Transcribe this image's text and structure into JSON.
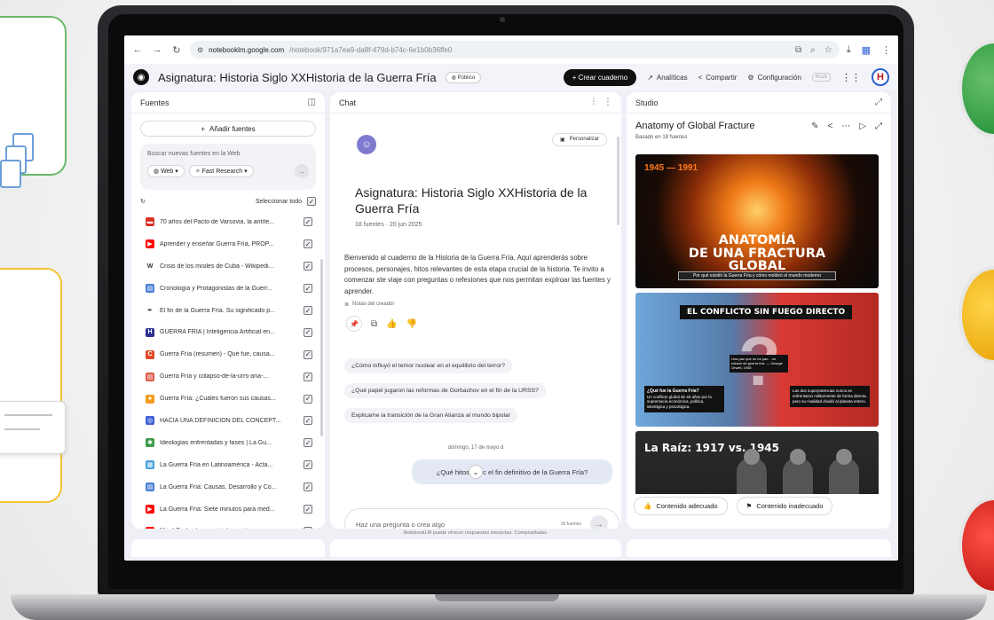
{
  "browser": {
    "url_host": "notebooklm.google.com",
    "url_path": "/notebook/971a7ea9-da8f-479d-b74c-6e1b0b36ffe0"
  },
  "header": {
    "notebook_title": "Asignatura: Historia Siglo XXHistoria de la Guerra Fría",
    "visibility": "Público",
    "create_label": "Crear cuaderno",
    "analytics_label": "Analíticas",
    "share_label": "Compartir",
    "settings_label": "Configuración",
    "plus_badge": "PLUS",
    "avatar_letter": "H"
  },
  "sources": {
    "panel_title": "Fuentes",
    "add_label": "Añadir fuentes",
    "search_placeholder": "Buscar nuevas fuentes en la Web",
    "web_chip": "Web",
    "research_chip": "Fast Research",
    "select_all": "Seleccionar todo",
    "items": [
      {
        "label": "70 años del Pacto de Varsovia, la antíte...",
        "icon": "doc-red-icon",
        "color": "#d93025",
        "glyph": "▬"
      },
      {
        "label": "Aprender y enseñar Guerra Fría, PROP...",
        "icon": "youtube-icon",
        "color": "#ff0000",
        "glyph": "▶"
      },
      {
        "label": "Crisis de los misiles de Cuba - Wikipedi...",
        "icon": "wikipedia-icon",
        "color": "#ffffff",
        "glyph": "W"
      },
      {
        "label": "Cronología y Protagonistas de la Guerr...",
        "icon": "pdf-icon",
        "color": "#4a7fd6",
        "glyph": "▤"
      },
      {
        "label": "El fin de la Guerra Fría. Su significado p...",
        "icon": "quill-icon",
        "color": "#ffffff",
        "glyph": "✒"
      },
      {
        "label": "GUERRA FRÍA | Inteligencia Artificial en...",
        "icon": "h-logo-icon",
        "color": "#2b2f8f",
        "glyph": "H"
      },
      {
        "label": "Guerra Fría (resumen) - Qué fue, causa...",
        "icon": "c-logo-icon",
        "color": "#e24a28",
        "glyph": "C"
      },
      {
        "label": "Guerra Fría y colapso-de-la-urrs-ana-...",
        "icon": "pdf-red-icon",
        "color": "#e05a4b",
        "glyph": "▤"
      },
      {
        "label": "Guerra Fría: ¿Cuáles fueron sus causas...",
        "icon": "flame-icon",
        "color": "#f29b1d",
        "glyph": "●"
      },
      {
        "label": "HACIA UNA DEFINICIÓN DEL CONCEPT...",
        "icon": "globe-blue-icon",
        "color": "#3f5fd8",
        "glyph": "◎"
      },
      {
        "label": "Ideologías enfrentadas y fases | La Gu...",
        "icon": "puzzle-icon",
        "color": "#3b9c4a",
        "glyph": "✱"
      },
      {
        "label": "La Guerra Fría en Latinoamérica - Acta...",
        "icon": "image-icon",
        "color": "#4aa3df",
        "glyph": "▦"
      },
      {
        "label": "La Guerra Fría: Causas, Desarrollo y Co...",
        "icon": "pdf-icon",
        "color": "#4a7fd6",
        "glyph": "▤"
      },
      {
        "label": "La Guerra Fría: Siete minutos para med...",
        "icon": "youtube-icon",
        "color": "#ff0000",
        "glyph": "▶"
      },
      {
        "label": "Mijail Gorbachov: quién fue y cómo ma...",
        "icon": "youtube-icon",
        "color": "#ff0000",
        "glyph": "▶"
      }
    ]
  },
  "chat": {
    "panel_title": "Chat",
    "personalize": "Personalizar",
    "title": "Asignatura: Historia Siglo XXHistoria de la Guerra Fría",
    "meta": "18 fuentes · 20 jun 2025",
    "description": "Bienvenido al cuaderno de la Historia de la Guerra Fría. Aquí aprenderás sobre procesos, personajes, hitos relevantes de esta etapa crucial de la historia. Te invito a comenzar ste viaje con preguntas o refexiones que nos permitan explroar las fuentes y aprender.",
    "creator_notes": "Notas del creador",
    "suggestions": [
      "¿Cómo influyó el temor nuclear en el equilibrio del terror?",
      "¿Qué papel jugaron las reformas de Gorbachov en el fin de la URSS?",
      "Explicame la transición de la Gran Alianza al mundo bipolar"
    ],
    "date": "domingo, 17 de mayo d",
    "user_message": "¿Qué hitos marc    el fin definitivo de la Guerra Fría?",
    "input_placeholder": "Haz una pregunta o crea algo",
    "source_count": "18 fuentes",
    "disclaimer": "NotebookLM puede ofrecer respuestas inexactas. Compruébalas."
  },
  "studio": {
    "panel_title": "Studio",
    "title": "Anatomy of Global Fracture",
    "based_on": "Basado en 18 fuentes",
    "slide1": {
      "years": "1945 — 1991",
      "title_line1": "ANATOMÍA",
      "title_line2": "DE UNA FRACTURA",
      "title_line3": "GLOBAL",
      "subtitle": "Por qué existió la Guerra Fría y cómo moldeó el mundo moderno"
    },
    "slide2": {
      "title": "EL CONFLICTO SIN FUEGO DIRECTO",
      "quote": "Una paz que no es paz... un estado de guerra fría. — George Orwell, 1945",
      "left_head": "¿Qué fue la Guerra Fría?",
      "left_body": "Un conflicto global de 45 años por la supremacía económica, política, ideológica y psicológica.",
      "right_head": "Las dos superpotencias nunca se enfrentaron militarmente de forma directa, pero su rivalidad dividió al planeta entero."
    },
    "slide3": {
      "title": "La Raíz: 1917 vs. 1945"
    },
    "feedback_good": "Contenido adecuado",
    "feedback_bad": "Contenido inadecuado"
  }
}
